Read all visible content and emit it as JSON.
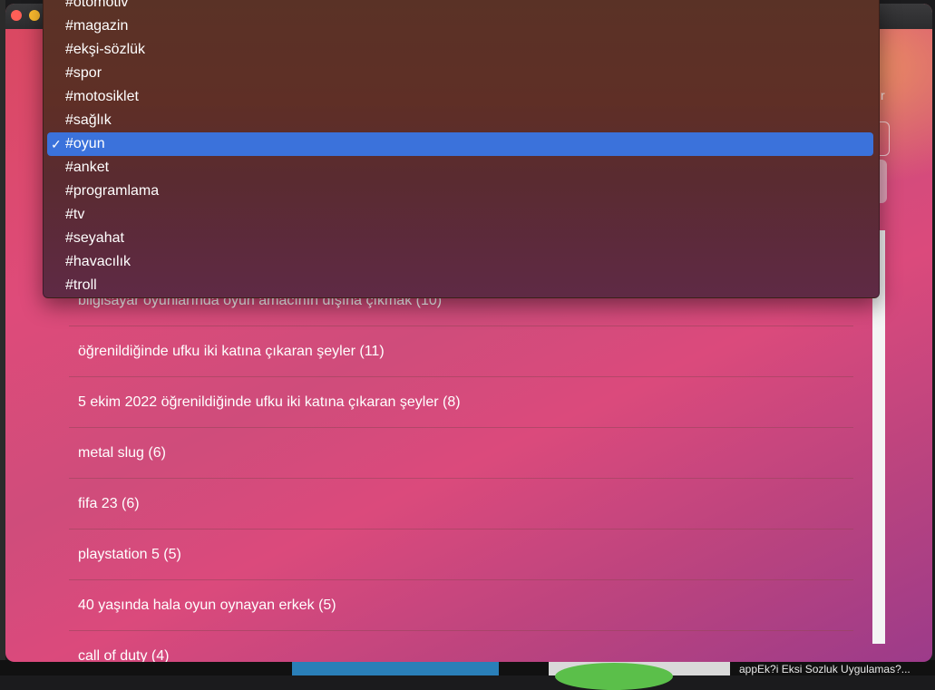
{
  "window": {
    "side_glyph": "r"
  },
  "dropdown": {
    "items": [
      {
        "label": "#otomotiv",
        "selected": false
      },
      {
        "label": "#magazin",
        "selected": false
      },
      {
        "label": "#ekşi-sözlük",
        "selected": false
      },
      {
        "label": "#spor",
        "selected": false
      },
      {
        "label": "#motosiklet",
        "selected": false
      },
      {
        "label": "#sağlık",
        "selected": false
      },
      {
        "label": "#oyun",
        "selected": true
      },
      {
        "label": "#anket",
        "selected": false
      },
      {
        "label": "#programlama",
        "selected": false
      },
      {
        "label": "#tv",
        "selected": false
      },
      {
        "label": "#seyahat",
        "selected": false
      },
      {
        "label": "#havacılık",
        "selected": false
      },
      {
        "label": "#troll",
        "selected": false
      }
    ],
    "checkmark": "✓"
  },
  "topics": [
    {
      "text": "bilgisayar oyunlarında oyun amacının dışına çıkmak (10)"
    },
    {
      "text": "öğrenildiğinde ufku iki katına çıkaran şeyler (11)"
    },
    {
      "text": "5 ekim 2022 öğrenildiğinde ufku iki katına çıkaran şeyler (8)"
    },
    {
      "text": "metal slug (6)"
    },
    {
      "text": "fifa 23 (6)"
    },
    {
      "text": "playstation 5 (5)"
    },
    {
      "text": "40 yaşında hala oyun oynayan erkek (5)"
    },
    {
      "text": "call of duty (4)"
    }
  ],
  "desktop": {
    "caption": "appEk?i Eksi Sozluk Uygulamas?..."
  },
  "colors": {
    "selected_highlight": "#3b72db",
    "close": "#ff5f57",
    "minimize": "#febc2e"
  }
}
